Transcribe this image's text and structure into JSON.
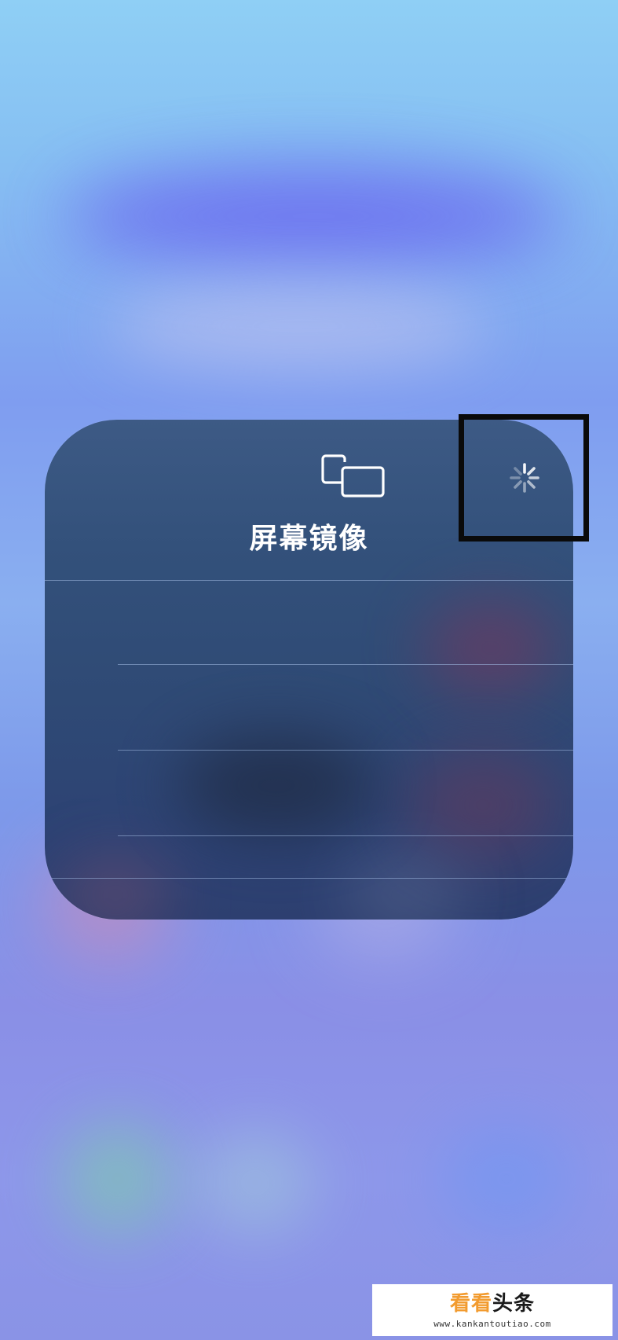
{
  "panel": {
    "title": "屏幕镜像",
    "header_icon": "screen-mirroring-icon",
    "status_icon": "loading-spinner-icon",
    "device_rows": [
      "",
      "",
      "",
      ""
    ]
  },
  "overlay": {
    "highlight_color": "#0a0a0a"
  },
  "watermark": {
    "brand_part1": "看看",
    "brand_part2": "头条",
    "url": "www.kankantoutiao.com"
  }
}
